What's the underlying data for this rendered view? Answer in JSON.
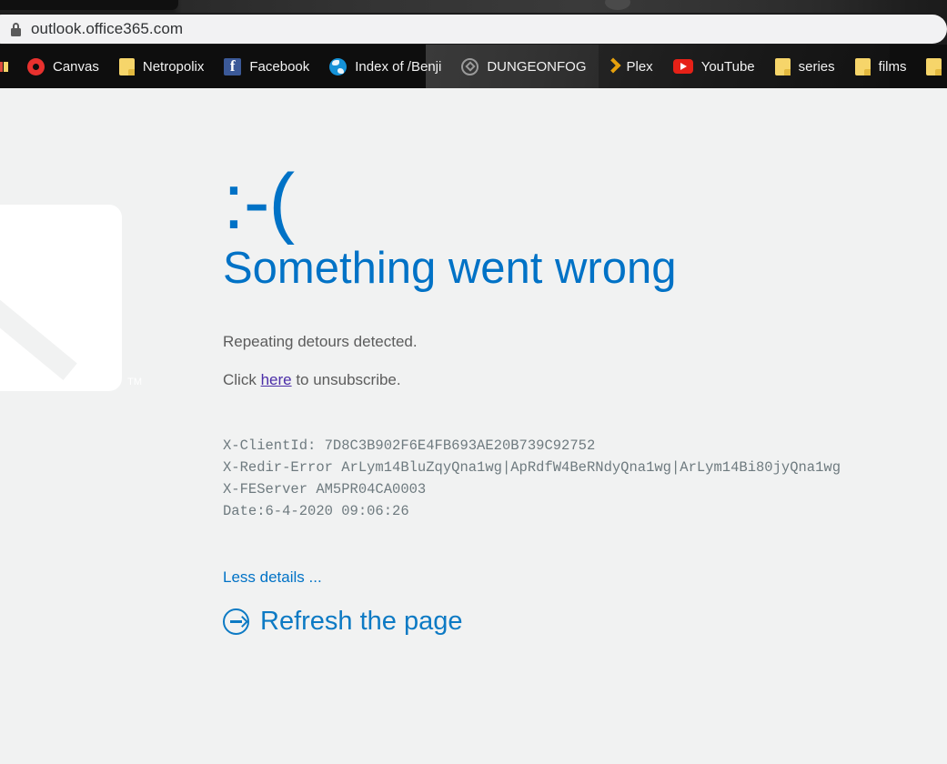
{
  "browser": {
    "address_bar": {
      "url": "outlook.office365.com",
      "lock_icon": "lock-icon"
    },
    "bookmarks": [
      {
        "label": "Canvas",
        "icon": "canvas-logo-icon"
      },
      {
        "label": "Netropolix",
        "icon": "folder-icon"
      },
      {
        "label": "Facebook",
        "icon": "facebook-icon"
      },
      {
        "label": "Index of /Benji",
        "icon": "globe-icon"
      },
      {
        "label": "DUNGEONFOG",
        "icon": "dungeonfog-logo-icon"
      },
      {
        "label": "Plex",
        "icon": "plex-icon"
      },
      {
        "label": "YouTube",
        "icon": "youtube-icon"
      },
      {
        "label": "series",
        "icon": "folder-icon"
      },
      {
        "label": "films",
        "icon": "folder-icon"
      }
    ]
  },
  "page": {
    "sad_face": ":-(",
    "headline": "Something went wrong",
    "message": "Repeating detours detected.",
    "unsubscribe": {
      "prefix": "Click ",
      "link": "here",
      "suffix": " to unsubscribe."
    },
    "details": {
      "client_id": "X-ClientId: 7D8C3B902F6E4FB693AE20B739C92752",
      "redir_error": "X-Redir-Error ArLym14BluZqyQna1wg|ApRdfW4BeRNdyQna1wg|ArLym14Bi80jyQna1wg",
      "fe_server": "X-FEServer AM5PR04CA0003",
      "date": "Date:6-4-2020 09:06:26"
    },
    "less_details_label": "Less details ...",
    "refresh_label": "Refresh the page",
    "watermark_tm": "TM"
  },
  "colors": {
    "accent_blue": "#0072c6",
    "refresh_blue": "#0d7ac4",
    "body_text": "#5c5c5c",
    "mono_text": "#6e7a7f",
    "link_visited": "#4b2ea8",
    "page_bg": "#f1f2f2",
    "chrome_bg": "#1b1b1b",
    "bookmarks_bg": "#0e0e0e"
  }
}
